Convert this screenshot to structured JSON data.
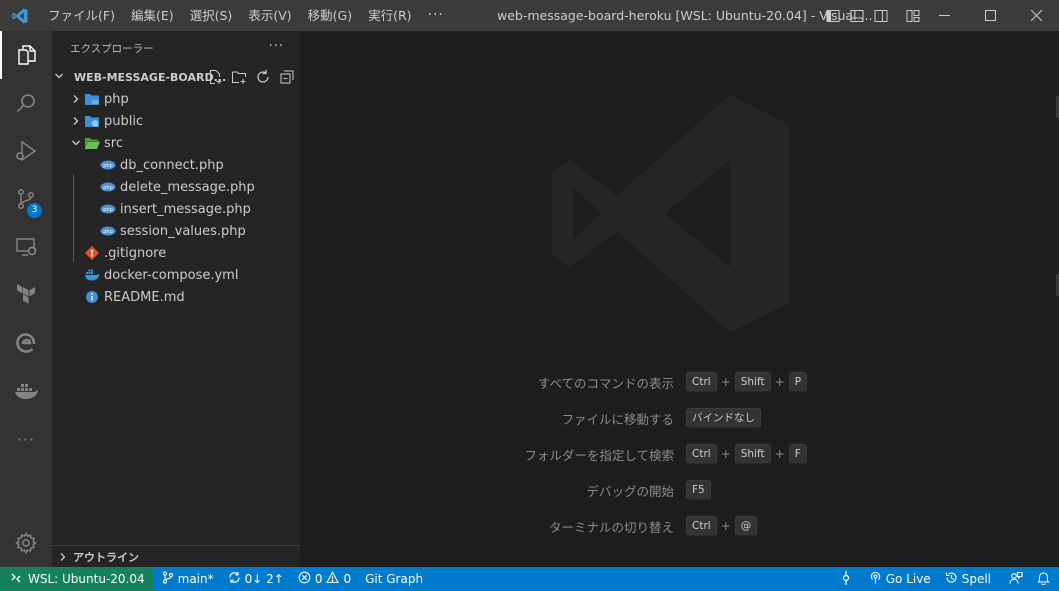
{
  "titlebar": {
    "menus": [
      "ファイル(F)",
      "編集(E)",
      "選択(S)",
      "表示(V)",
      "移動(G)",
      "実行(R)"
    ],
    "more": "···",
    "window_title": "web-message-board-heroku [WSL: Ubuntu-20.04] - Visual ..."
  },
  "activity": {
    "items": [
      "explorer-icon",
      "search-icon",
      "run-debug-icon",
      "source-control-icon",
      "remote-explorer-icon",
      "terraform-icon",
      "edge-icon",
      "docker-icon",
      "more-icon"
    ],
    "source_control_badge": "3",
    "more": "···"
  },
  "sidebar": {
    "title": "エクスプローラー",
    "more": "···",
    "folder": "WEB-MESSAGE-BOARD...",
    "tree": [
      {
        "label": "php",
        "type": "folder",
        "expanded": false,
        "color": "#3d8fd6"
      },
      {
        "label": "public",
        "type": "folder",
        "expanded": false,
        "color": "#3d8fd6"
      },
      {
        "label": "src",
        "type": "folder",
        "expanded": true,
        "color": "#5aa84a"
      },
      {
        "label": "db_connect.php",
        "type": "php"
      },
      {
        "label": "delete_message.php",
        "type": "php"
      },
      {
        "label": "insert_message.php",
        "type": "php"
      },
      {
        "label": "session_values.php",
        "type": "php"
      },
      {
        "label": ".gitignore",
        "type": "git"
      },
      {
        "label": "docker-compose.yml",
        "type": "docker"
      },
      {
        "label": "README.md",
        "type": "info"
      }
    ],
    "outline": "アウトライン"
  },
  "editor": {
    "shortcuts": [
      {
        "label": "すべてのコマンドの表示",
        "keys": [
          "Ctrl",
          "Shift",
          "P"
        ]
      },
      {
        "label": "ファイルに移動する",
        "keys": [
          "バインドなし"
        ]
      },
      {
        "label": "フォルダーを指定して検索",
        "keys": [
          "Ctrl",
          "Shift",
          "F"
        ]
      },
      {
        "label": "デバッグの開始",
        "keys": [
          "F5"
        ]
      },
      {
        "label": "ターミナルの切り替え",
        "keys": [
          "Ctrl",
          "@"
        ]
      }
    ],
    "plus": "+"
  },
  "statusbar": {
    "remote": "WSL: Ubuntu-20.04",
    "branch": "main*",
    "sync": "0↓ 2↑",
    "errors": "0",
    "warnings": "0",
    "git_graph": "Git Graph",
    "go_live": "Go Live",
    "spell": "Spell"
  },
  "colors": {
    "accent": "#007acc",
    "remote": "#16825d",
    "php": "#4a8fd8",
    "git": "#e44d26"
  }
}
